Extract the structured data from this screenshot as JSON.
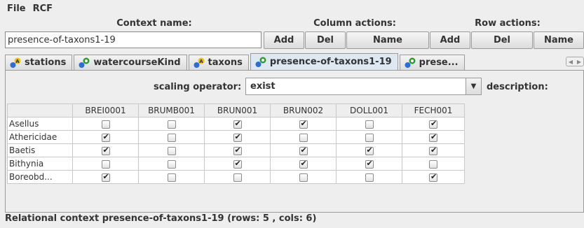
{
  "menu": [
    "File",
    "RCF"
  ],
  "headers": {
    "context_name": "Context name:",
    "column_actions": "Column actions:",
    "row_actions": "Row actions:"
  },
  "context_name_value": "presence-of-taxons1-19",
  "column_buttons": [
    "Add",
    "Del",
    "Name"
  ],
  "row_buttons": [
    "Add",
    "Del",
    "Name"
  ],
  "tabs": [
    {
      "label": "stations",
      "icon": "object-attribute-icon",
      "active": false
    },
    {
      "label": "watercourseKind",
      "icon": "object-object-icon",
      "active": false
    },
    {
      "label": "taxons",
      "icon": "object-attribute-icon",
      "active": false
    },
    {
      "label": "presence-of-taxons1-19",
      "icon": "object-object-icon",
      "active": true
    },
    {
      "label": "prese...",
      "icon": "object-object-icon",
      "active": false
    }
  ],
  "scaling": {
    "label": "scaling operator:",
    "value": "exist",
    "description_label": "description:"
  },
  "table": {
    "columns": [
      "BREI0001",
      "BRUMB001",
      "BRUN001",
      "BRUN002",
      "DOLL001",
      "FECH001"
    ],
    "rows": [
      {
        "name": "Asellus",
        "values": [
          false,
          false,
          true,
          true,
          false,
          true
        ]
      },
      {
        "name": "Athericidae",
        "values": [
          true,
          false,
          true,
          false,
          false,
          true
        ]
      },
      {
        "name": "Baetis",
        "values": [
          true,
          false,
          true,
          true,
          true,
          true
        ]
      },
      {
        "name": "Bithynia",
        "values": [
          false,
          false,
          true,
          true,
          true,
          false
        ]
      },
      {
        "name": "Boreobd...",
        "values": [
          true,
          false,
          false,
          false,
          false,
          true
        ]
      }
    ]
  },
  "status": "Relational context presence-of-taxons1-19 (rows: 5 , cols: 6)",
  "colors": {
    "active_tab": "#dde8f3",
    "background": "#eeeeee",
    "icon_blue": "#2a6fd6",
    "icon_green": "#2e9b2e",
    "icon_yellow": "#e8c21a"
  }
}
